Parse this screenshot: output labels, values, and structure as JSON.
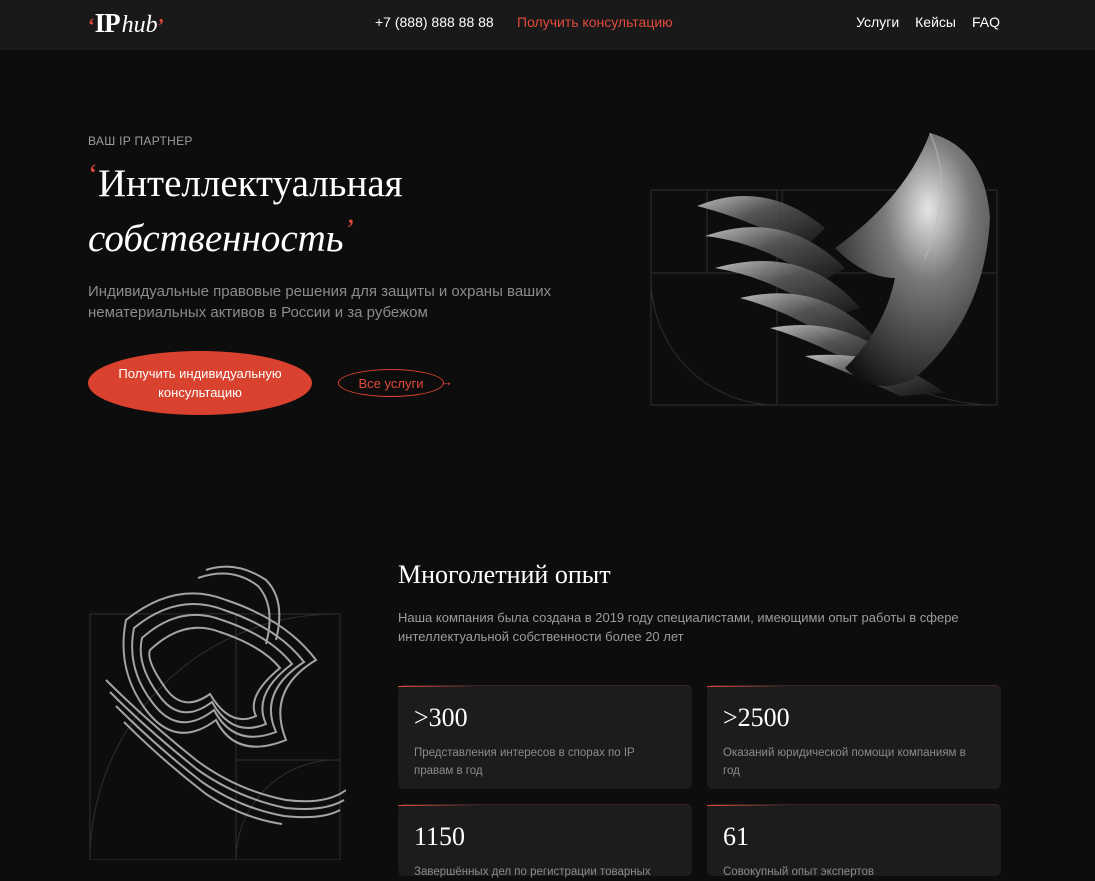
{
  "header": {
    "logo_text_ip": "IP",
    "logo_text_hub": "hub",
    "phone": "+7 (888) 888 88 88",
    "consult_link": "Получить консультацию",
    "nav": [
      "Услуги",
      "Кейсы",
      "FAQ"
    ]
  },
  "hero": {
    "eyebrow": "ВАШ IP ПАРТНЕР",
    "title_line1": "Интеллектуальная",
    "title_line2": "собственность",
    "description": "Индивидуальные правовые решения для защиты и охраны ваших нематериальных активов в России и за рубежом",
    "cta_line1": "Получить индивидуальную",
    "cta_line2": "консультацию",
    "all_services": "Все услуги"
  },
  "experience": {
    "title": "Многолетний опыт",
    "description": "Наша компания была создана в 2019 году специалистами, имеющими опыт работы в сфере интеллектуальной собственности более 20 лет",
    "stats": [
      {
        "value": ">300",
        "label": "Представления интересов в спорах по IP правам в год"
      },
      {
        "value": ">2500",
        "label": "Оказаний юридической помощи компаниям в год"
      },
      {
        "value": "1150",
        "label": "Завершённых дел по регистрации товарных"
      },
      {
        "value": "61",
        "label": "Совокупный опыт экспертов"
      }
    ]
  },
  "colors": {
    "accent": "#e04a3b",
    "background": "#0e0d0d",
    "header_bg": "#1a1919",
    "card_bg": "#1d1c1c"
  }
}
